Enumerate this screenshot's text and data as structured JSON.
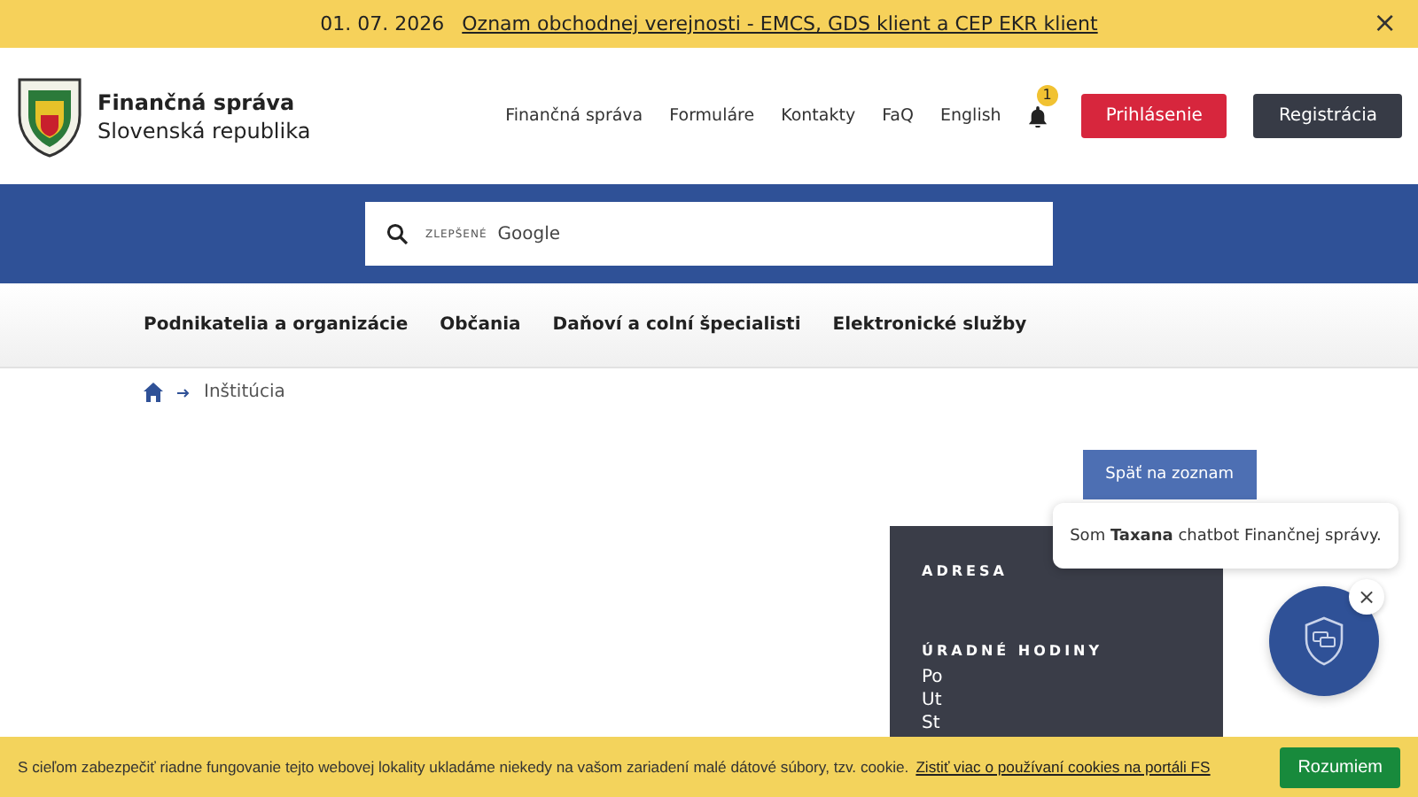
{
  "announcement": {
    "date": "01. 07. 2026",
    "link": "Oznam obchodnej verejnosti - EMCS, GDS klient a CEP EKR klient",
    "close": "×"
  },
  "header": {
    "title": "Finančná správa",
    "subtitle": "Slovenská republika",
    "links": [
      "Finančná správa",
      "Formuláre",
      "Kontakty",
      "FaQ",
      "English"
    ],
    "notifications": "1",
    "buttons": [
      {
        "label": "Prihlásenie",
        "kind": "primary"
      },
      {
        "label": "Registrácia",
        "kind": "secondary"
      }
    ]
  },
  "search": {
    "placeholder_prefix": "ZLEPŠENÉ",
    "placeholder": "Google"
  },
  "nav": [
    "Podnikatelia a organizácie",
    "Občania",
    "Daňoví a colní špecialisti",
    "Elektronické služby"
  ],
  "breadcrumb": [
    "Inštitúcia"
  ],
  "back_button": "Späť na zoznam",
  "info_panel": {
    "sections": [
      {
        "heading": "ADRESA"
      },
      {
        "heading": "ÚRADNÉ HODINY",
        "lines": [
          "Po",
          "Ut",
          "St"
        ]
      }
    ]
  },
  "chatbot": {
    "message": "Som **Taxana** chatbot Finančnej správy.",
    "close": "×"
  },
  "cookie_bar": {
    "text": "S cieľom zabezpečiť riadne fungovanie tejto webovej lokality ukladáme niekedy na vašom zariadení malé dátové súbory, tzv. cookie.",
    "link": "Zistiť viac o používaní cookies na portáli FS",
    "button": "Rozumiem"
  }
}
